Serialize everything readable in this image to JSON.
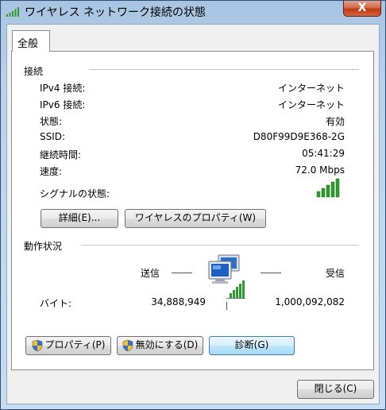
{
  "window": {
    "title": "ワイヤレス ネットワーク接続の状態",
    "close_label": "X"
  },
  "tabs": [
    {
      "label": "全般"
    }
  ],
  "connection": {
    "heading": "接続",
    "rows": [
      {
        "label": "IPv4 接続:",
        "value": "インターネット"
      },
      {
        "label": "IPv6 接続:",
        "value": "インターネット"
      },
      {
        "label": "状態:",
        "value": "有効"
      },
      {
        "label": "SSID:",
        "value": "D80F99D9E368-2G"
      },
      {
        "label": "継続時間:",
        "value": "05:41:29"
      },
      {
        "label": "速度:",
        "value": "72.0 Mbps"
      }
    ],
    "signal_label": "シグナルの状態:",
    "signal_bars": 5,
    "signal_max": 5,
    "details_button": "詳細(E)...",
    "wireless_props_button": "ワイヤレスのプロパティ(W)"
  },
  "activity": {
    "heading": "動作状況",
    "sent_label": "送信",
    "received_label": "受信",
    "bytes_label": "バイト:",
    "sent_bytes": "34,888,949",
    "received_bytes": "1,000,092,082"
  },
  "buttons": {
    "properties": "プロパティ(P)",
    "disable": "無効にする(D)",
    "diagnose": "診断(G)",
    "close": "閉じる(C)"
  },
  "colors": {
    "signal_green": "#2f9b2f",
    "title_bar": "#b9d2ec"
  }
}
